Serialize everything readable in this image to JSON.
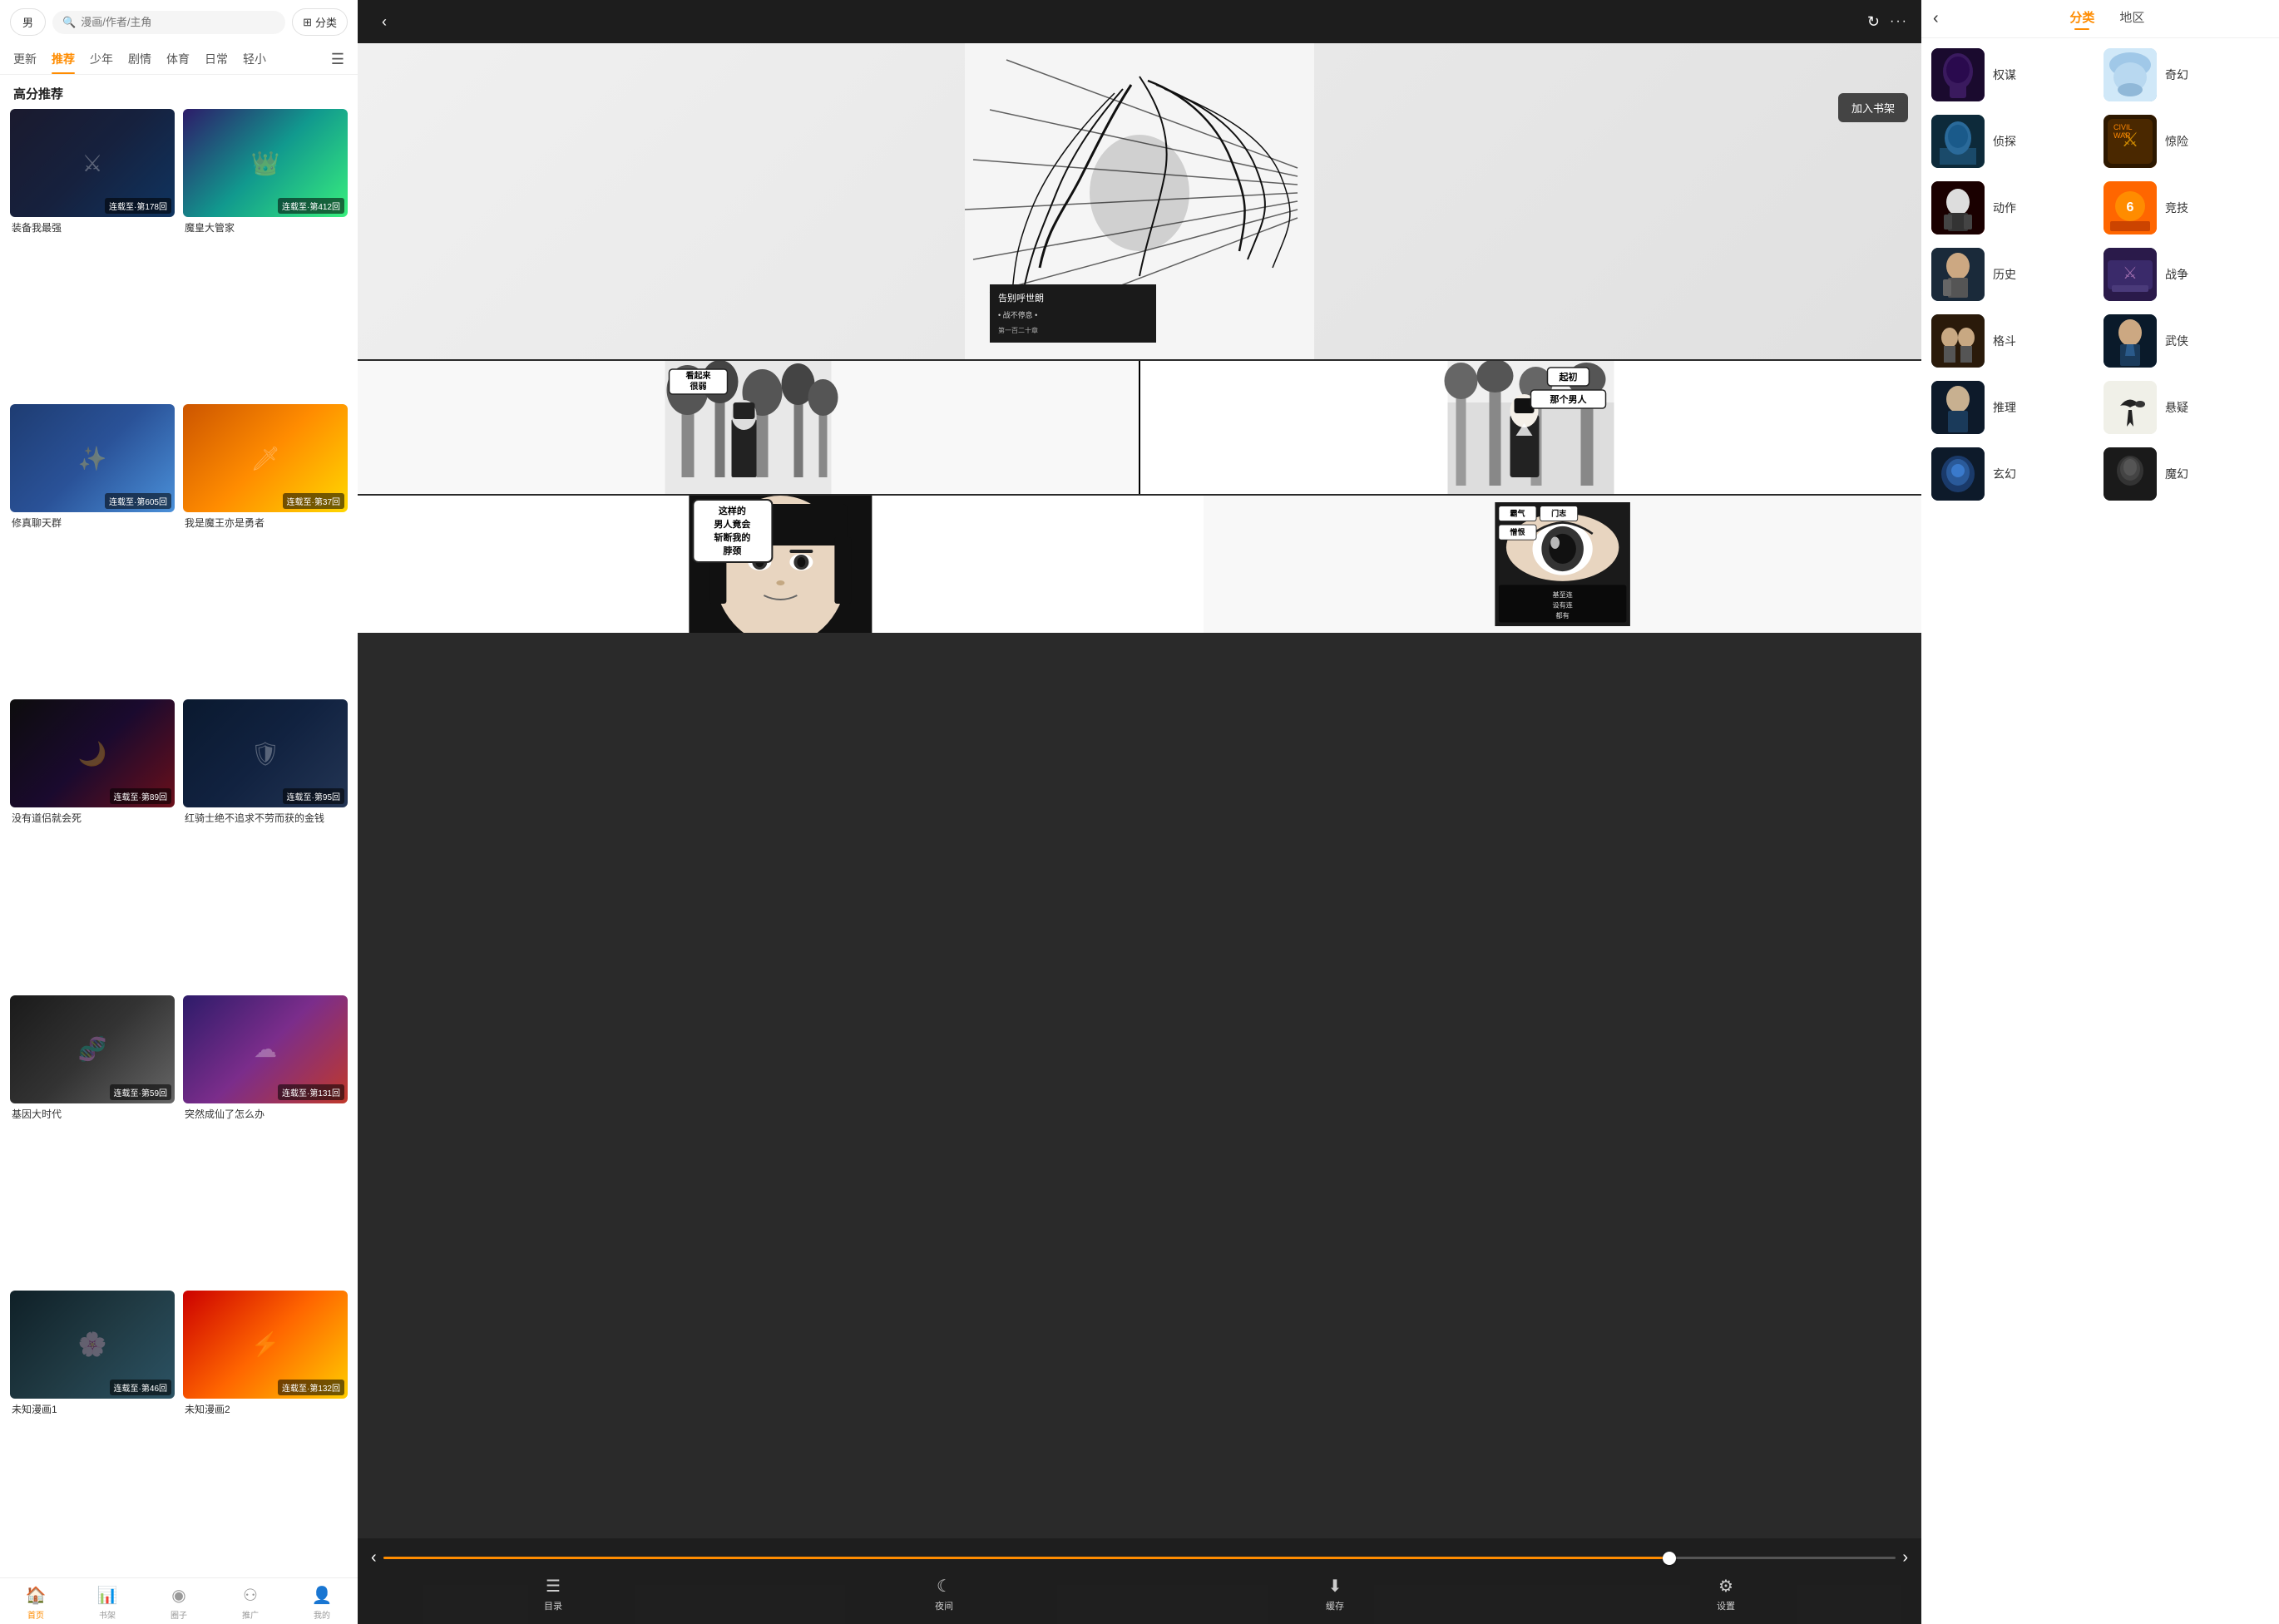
{
  "left": {
    "gender_btn": "男",
    "search_placeholder": "漫画/作者/主角",
    "classify_btn": "分类",
    "nav_tabs": [
      {
        "label": "更新",
        "active": false
      },
      {
        "label": "推荐",
        "active": true
      },
      {
        "label": "少年",
        "active": false
      },
      {
        "label": "剧情",
        "active": false
      },
      {
        "label": "体育",
        "active": false
      },
      {
        "label": "日常",
        "active": false
      },
      {
        "label": "轻小",
        "active": false
      }
    ],
    "section_title": "高分推荐",
    "manga_items": [
      {
        "title": "装备我最强",
        "badge": "连载至·第178回",
        "color": "card-color-1"
      },
      {
        "title": "魔皇大管家",
        "badge": "连载至·第412回",
        "color": "card-color-2"
      },
      {
        "title": "修真聊天群",
        "badge": "连载至·第605回",
        "color": "card-color-3"
      },
      {
        "title": "我是魔王亦是勇者",
        "badge": "连载至·第37回",
        "color": "card-color-4"
      },
      {
        "title": "没有道侣就会死",
        "badge": "连载至·第89回",
        "color": "card-color-5"
      },
      {
        "title": "红骑士绝不追求不劳而获的金钱",
        "badge": "连载至·第95回",
        "color": "card-color-6"
      },
      {
        "title": "基因大时代",
        "badge": "连载至·第59回",
        "color": "card-color-7"
      },
      {
        "title": "突然成仙了怎么办",
        "badge": "连载至·第131回",
        "color": "card-color-8"
      },
      {
        "title": "未知漫画1",
        "badge": "连载至·第46回",
        "color": "card-color-9"
      },
      {
        "title": "未知漫画2",
        "badge": "连载至·第132回",
        "color": "card-color-10"
      }
    ],
    "bottom_nav": [
      {
        "label": "首页",
        "active": true,
        "icon": "🏠"
      },
      {
        "label": "书架",
        "active": false,
        "icon": "📚"
      },
      {
        "label": "圈子",
        "active": false,
        "icon": "👤"
      },
      {
        "label": "推广",
        "active": false,
        "icon": "🔗"
      },
      {
        "label": "我的",
        "active": false,
        "icon": "👤"
      }
    ]
  },
  "middle": {
    "add_shelf_btn": "加入书架",
    "reader_actions": [
      {
        "label": "目录",
        "icon": "☰"
      },
      {
        "label": "夜间",
        "icon": "🌙"
      },
      {
        "label": "缓存",
        "icon": "⬇"
      },
      {
        "label": "设置",
        "icon": "⚙"
      }
    ],
    "progress_percent": 85,
    "page_texts": {
      "page2_left_bubble1": "看起来很弱",
      "page2_right_bubble1": "起初",
      "page2_right_bubble2": "那个男人",
      "page3_left_lines": [
        "这样的",
        "男人竟会",
        "斩断我的",
        "脖颈"
      ],
      "page3_right_line1": "霸气",
      "page3_right_line2": "门志",
      "page3_right_line3": "憎恨",
      "page3_right_line4": "基至连",
      "page3_right_line5": "设有连",
      "page3_right_line6": "都有"
    }
  },
  "right": {
    "back_icon": "‹",
    "tabs": [
      {
        "label": "分类",
        "active": true
      },
      {
        "label": "地区",
        "active": false
      }
    ],
    "genres": [
      {
        "label_left": "权谋",
        "label_right": "奇幻",
        "color_left": "genre-thumb-1",
        "color_right": "genre-thumb-2"
      },
      {
        "label_left": "侦探",
        "label_right": "惊险",
        "color_left": "genre-thumb-3",
        "color_right": "genre-thumb-4"
      },
      {
        "label_left": "动作",
        "label_right": "竞技",
        "color_left": "genre-thumb-5",
        "color_right": "genre-thumb-6"
      },
      {
        "label_left": "历史",
        "label_right": "战争",
        "color_left": "genre-thumb-7",
        "color_right": "genre-thumb-8"
      },
      {
        "label_left": "格斗",
        "label_right": "武侠",
        "color_left": "genre-thumb-9",
        "color_right": "genre-thumb-10"
      },
      {
        "label_left": "推理",
        "label_right": "悬疑",
        "color_left": "genre-thumb-1",
        "color_right": "genre-thumb-3"
      },
      {
        "label_left": "玄幻",
        "label_right": "魔幻",
        "color_left": "genre-thumb-5",
        "color_right": "genre-thumb-7"
      }
    ]
  }
}
